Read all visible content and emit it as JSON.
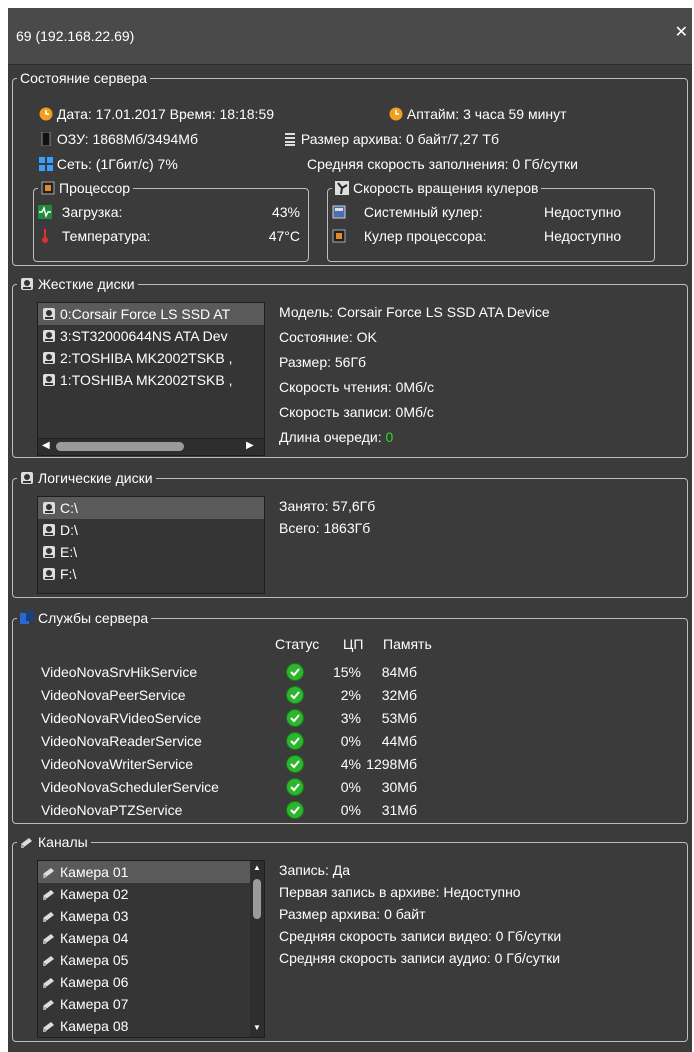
{
  "window": {
    "title": "69 (192.168.22.69)",
    "close_glyph": "✕"
  },
  "server_state": {
    "legend": "Состояние сервера",
    "date_line": "Дата: 17.01.2017 Время: 18:18:59",
    "uptime": "Аптайм: 3 часа 59 минут",
    "ram": "ОЗУ: 1868Мб/3494Мб",
    "archive_size": "Размер архива: 0 байт/7,27 Тб",
    "network": "Сеть: (1Гбит/с) 7%",
    "fill_speed": "Средняя скорость заполнения: 0 Гб/сутки",
    "cpu": {
      "legend": "Процессор",
      "load_label": "Загрузка:",
      "load_value": "43%",
      "temp_label": "Температура:",
      "temp_value": "47°C"
    },
    "fans": {
      "legend": "Скорость вращения кулеров",
      "system_label": "Системный кулер:",
      "system_value": "Недоступно",
      "cpu_label": "Кулер процессора:",
      "cpu_value": "Недоступно"
    }
  },
  "hard_disks": {
    "legend": "Жесткие диски",
    "items": [
      "0:Corsair Force LS SSD AT",
      "3:ST32000644NS ATA Dev",
      "2:TOSHIBA MK2002TSKB ,",
      "1:TOSHIBA MK2002TSKB ,"
    ],
    "model": "Модель: Corsair Force LS SSD ATA Device",
    "status": "Состояние: OK",
    "size": "Размер: 56Гб",
    "read_speed": "Скорость чтения: 0Мб/с",
    "write_speed": "Скорость записи: 0Мб/с",
    "queue_label": "Длина очереди:",
    "queue_value": "0"
  },
  "logical_disks": {
    "legend": "Логические диски",
    "items": [
      "C:\\",
      "D:\\",
      "E:\\",
      "F:\\"
    ],
    "used": "Занято: 57,6Гб",
    "total": "Всего: 1863Гб"
  },
  "services": {
    "legend": "Службы сервера",
    "headers": {
      "status": "Статус",
      "cpu": "ЦП",
      "memory": "Память"
    },
    "rows": [
      {
        "name": "VideoNovaSrvHikService",
        "cpu": "15%",
        "mem": "84Мб"
      },
      {
        "name": "VideoNovaPeerService",
        "cpu": "2%",
        "mem": "32Мб"
      },
      {
        "name": "VideoNovaRVideoService",
        "cpu": "3%",
        "mem": "53Мб"
      },
      {
        "name": "VideoNovaReaderService",
        "cpu": "0%",
        "mem": "44Мб"
      },
      {
        "name": "VideoNovaWriterService",
        "cpu": "4%",
        "mem": "1298Мб"
      },
      {
        "name": "VideoNovaSchedulerService",
        "cpu": "0%",
        "mem": "30Мб"
      },
      {
        "name": "VideoNovaPTZService",
        "cpu": "0%",
        "mem": "31Мб"
      }
    ]
  },
  "channels": {
    "legend": "Каналы",
    "items": [
      "Камера 01",
      "Камера 02",
      "Камера 03",
      "Камера 04",
      "Камера 05",
      "Камера 06",
      "Камера 07",
      "Камера 08"
    ],
    "recording": "Запись: Да",
    "first_record": "Первая запись в архиве: Недоступно",
    "archive_size": "Размер архива: 0 байт",
    "video_speed": "Средняя скорость записи видео: 0 Гб/сутки",
    "audio_speed": "Средняя скорость записи аудио: 0 Гб/сутки"
  },
  "colors": {
    "background": "#3b3b3b",
    "ok_green": "#2ed82e",
    "selection": "#5a5a5a"
  }
}
